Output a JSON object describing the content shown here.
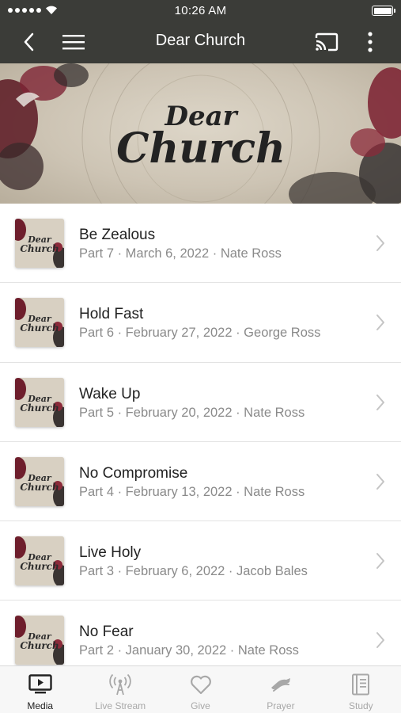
{
  "status": {
    "time": "10:26 AM"
  },
  "navbar": {
    "title": "Dear Church"
  },
  "hero": {
    "line1": "Dear",
    "line2": "Church"
  },
  "sermons": [
    {
      "title": "Be Zealous",
      "subtitle": "Part 7 · March 6, 2022 · Nate Ross"
    },
    {
      "title": "Hold Fast",
      "subtitle": "Part 6 · February 27, 2022 · George Ross"
    },
    {
      "title": "Wake Up",
      "subtitle": "Part 5 · February 20, 2022 · Nate Ross"
    },
    {
      "title": "No Compromise",
      "subtitle": "Part 4 · February 13, 2022 · Nate Ross"
    },
    {
      "title": "Live Holy",
      "subtitle": "Part 3 · February 6, 2022 · Jacob Bales"
    },
    {
      "title": "No Fear",
      "subtitle": "Part 2 · January 30, 2022 · Nate Ross"
    }
  ],
  "tabs": [
    {
      "label": "Media",
      "icon": "tv-icon",
      "active": true
    },
    {
      "label": "Live Stream",
      "icon": "antenna-icon",
      "active": false
    },
    {
      "label": "Give",
      "icon": "heart-icon",
      "active": false
    },
    {
      "label": "Prayer",
      "icon": "praying-hands-icon",
      "active": false
    },
    {
      "label": "Study",
      "icon": "book-icon",
      "active": false
    }
  ],
  "colors": {
    "navbar": "#3b3c38",
    "accent": "#8e1f2e",
    "tab_active": "#222222",
    "tab_inactive": "#a8a8a8"
  }
}
